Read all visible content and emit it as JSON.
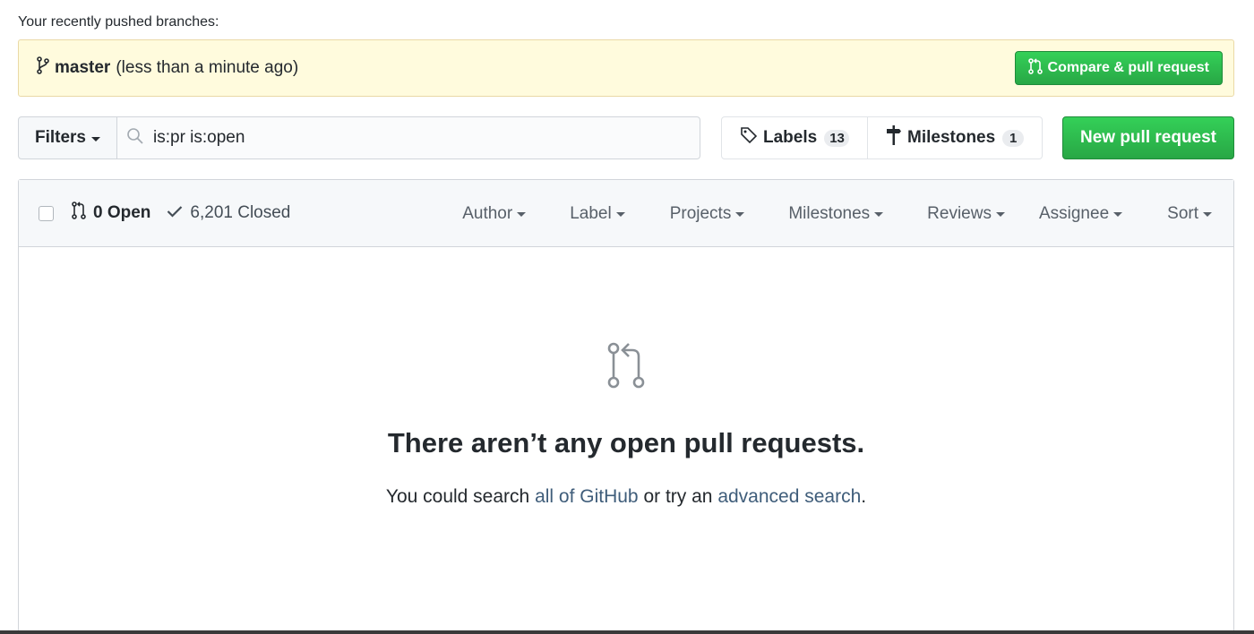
{
  "recent": {
    "title": "Your recently pushed branches:",
    "branch_name": "master",
    "branch_time": "(less than a minute ago)",
    "compare_label": "Compare & pull request"
  },
  "filters": {
    "filters_label": "Filters",
    "search_value": "is:pr is:open",
    "labels_label": "Labels",
    "labels_count": "13",
    "milestones_label": "Milestones",
    "milestones_count": "1",
    "new_pr_label": "New pull request"
  },
  "list_header": {
    "open_label": "0 Open",
    "closed_label": "6,201 Closed",
    "menus": [
      "Author",
      "Label",
      "Projects",
      "Milestones",
      "Reviews",
      "Assignee",
      "Sort"
    ]
  },
  "blankslate": {
    "title": "There aren’t any open pull requests.",
    "text_prefix": "You could search ",
    "link_all": "all of GitHub",
    "text_middle": " or try an ",
    "link_advanced": "advanced search",
    "text_suffix": "."
  },
  "colors": {
    "accent_green": "#28a745",
    "banner_yellow": "#fffbdd",
    "link": "#3f5d7a"
  }
}
